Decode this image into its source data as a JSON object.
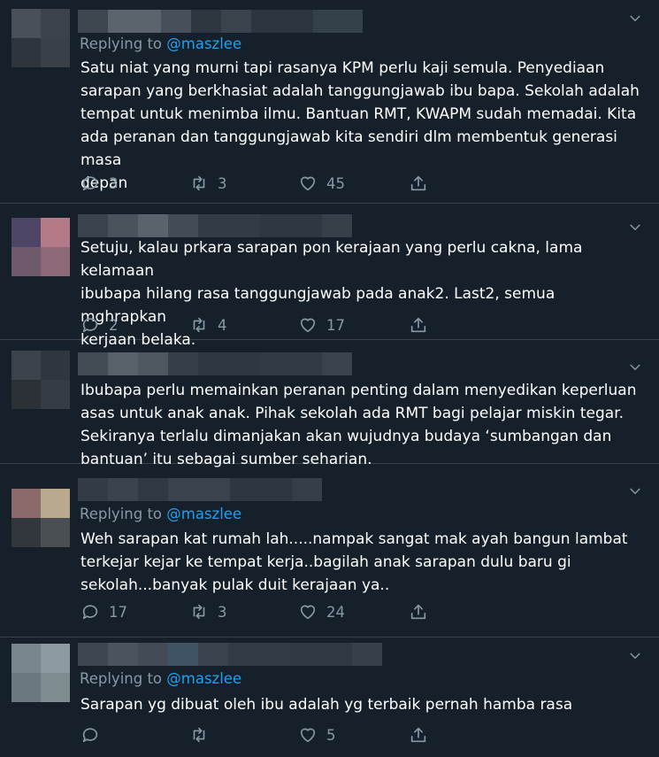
{
  "colors": {
    "background": "#15202b",
    "divider": "#38444d",
    "muted": "#8899a6",
    "link": "#1da1f2",
    "text": "#ffffff"
  },
  "icons": {
    "reply": "reply-bubble-icon",
    "retweet": "retweet-icon",
    "like": "heart-icon",
    "share": "share-upload-icon",
    "menu": "chevron-down-icon"
  },
  "replies": [
    {
      "replying_prefix": "Replying to",
      "replying_handle": "@maszlee",
      "text": "Satu niat yang murni tapi rasanya KPM perlu kaji semula. Penyediaan\nsarapan yang berkhasiat adalah tanggungjawab ibu bapa. Sekolah adalah\ntempat untuk menimba ilmu. Bantuan RMT, KWAPM sudah memadai. Kita\nada peranan dan tanggungjawab kita sendiri dlm membentuk generasi masa\ndepan",
      "replies": "3",
      "retweets": "3",
      "likes": "45"
    },
    {
      "text": "Setuju, kalau prkara sarapan pon kerajaan yang perlu cakna, lama kelamaan\nibubapa hilang rasa tanggungjawab pada anak2. Last2, semua mghrapkan\nkerjaan belaka.",
      "replies": "2",
      "retweets": "4",
      "likes": "17"
    },
    {
      "text": "Ibubapa perlu memainkan peranan penting dalam menyedikan keperluan\nasas untuk anak anak. Pihak sekolah ada RMT bagi pelajar miskin tegar.\nSekiranya terlalu dimanjakan akan wujudnya budaya ‘sumbangan dan\nbantuan’ itu sebagai sumber seharian."
    },
    {
      "replying_prefix": "Replying to",
      "replying_handle": "@maszlee",
      "text": "Weh sarapan kat rumah lah.....nampak sangat mak ayah bangun lambat\nterkejar kejar ke tempat kerja..bagilah anak sarapan dulu baru gi\nsekolah...banyak pulak duit kerajaan ya..",
      "replies": "17",
      "retweets": "3",
      "likes": "24"
    },
    {
      "replying_prefix": "Replying to",
      "replying_handle": "@maszlee",
      "text": "Sarapan yg dibuat oleh ibu adalah yg terbaik pernah hamba rasa",
      "replies": "",
      "retweets": "",
      "likes": "5"
    }
  ]
}
